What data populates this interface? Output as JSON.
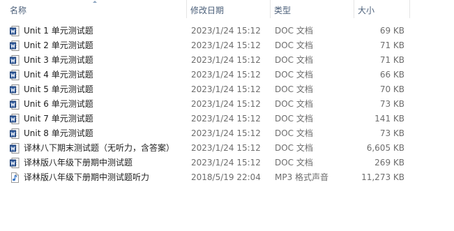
{
  "columns": {
    "name": "名称",
    "date": "修改日期",
    "type": "类型",
    "size": "大小"
  },
  "colors": {
    "header_text": "#4c607a",
    "secondary_text": "#6d6d6d",
    "doc_icon": "#2b579a",
    "mp3_icon": "#3a78c9"
  },
  "files": [
    {
      "name": "Unit 1 单元测试题",
      "date": "2023/1/24 15:12",
      "type": "DOC 文档",
      "size": "69 KB",
      "icon": "word-doc-icon"
    },
    {
      "name": "Unit 2 单元测试题",
      "date": "2023/1/24 15:12",
      "type": "DOC 文档",
      "size": "71 KB",
      "icon": "word-doc-icon"
    },
    {
      "name": "Unit 3 单元测试题",
      "date": "2023/1/24 15:12",
      "type": "DOC 文档",
      "size": "71 KB",
      "icon": "word-doc-icon"
    },
    {
      "name": "Unit 4 单元测试题",
      "date": "2023/1/24 15:12",
      "type": "DOC 文档",
      "size": "66 KB",
      "icon": "word-doc-icon"
    },
    {
      "name": "Unit 5 单元测试题",
      "date": "2023/1/24 15:12",
      "type": "DOC 文档",
      "size": "70 KB",
      "icon": "word-doc-icon"
    },
    {
      "name": "Unit 6 单元测试题",
      "date": "2023/1/24 15:12",
      "type": "DOC 文档",
      "size": "73 KB",
      "icon": "word-doc-icon"
    },
    {
      "name": "Unit 7 单元测试题",
      "date": "2023/1/24 15:12",
      "type": "DOC 文档",
      "size": "141 KB",
      "icon": "word-doc-icon"
    },
    {
      "name": "Unit 8 单元测试题",
      "date": "2023/1/24 15:12",
      "type": "DOC 文档",
      "size": "73 KB",
      "icon": "word-doc-icon"
    },
    {
      "name": "译林八下期末测试题（无听力，含答案）",
      "date": "2023/1/24 15:12",
      "type": "DOC 文档",
      "size": "6,605 KB",
      "icon": "word-doc-icon"
    },
    {
      "name": "译林版八年级下册期中测试题",
      "date": "2023/1/24 15:12",
      "type": "DOC 文档",
      "size": "269 KB",
      "icon": "word-doc-icon"
    },
    {
      "name": "译林版八年级下册期中测试题听力",
      "date": "2018/5/19 22:04",
      "type": "MP3 格式声音",
      "size": "11,273 KB",
      "icon": "audio-file-icon"
    }
  ]
}
